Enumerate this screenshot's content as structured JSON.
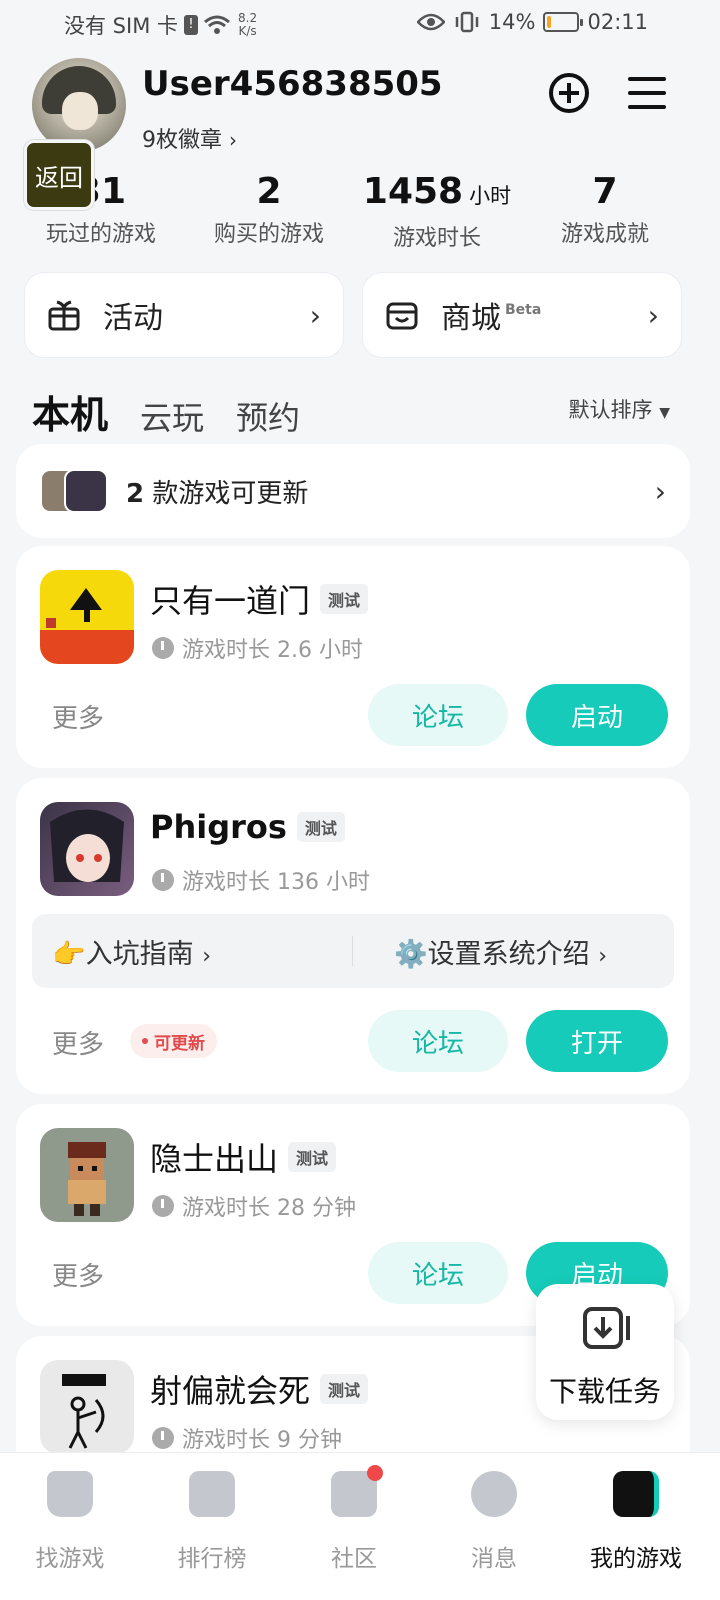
{
  "status_bar": {
    "carrier": "没有 SIM 卡",
    "net_speed_value": "8.2",
    "net_speed_unit": "K/s",
    "battery": "14%",
    "battery_level": 0.14,
    "time": "02:11"
  },
  "profile": {
    "username": "User456838505",
    "badges": "9枚徽章",
    "back_label": "返回"
  },
  "stats": [
    {
      "value": "31",
      "unit": "",
      "label": "玩过的游戏"
    },
    {
      "value": "2",
      "unit": "",
      "label": "购买的游戏"
    },
    {
      "value": "1458",
      "unit": "小时",
      "label": "游戏时长"
    },
    {
      "value": "7",
      "unit": "",
      "label": "游戏成就"
    }
  ],
  "quick": {
    "activity": "活动",
    "mall": "商城",
    "mall_badge": "Beta"
  },
  "tabs": [
    "本机",
    "云玩",
    "预约"
  ],
  "sort_label": "默认排序",
  "update_bar": {
    "count": "2",
    "text": "款游戏可更新"
  },
  "games": [
    {
      "name": "只有一道门",
      "tag": "测试",
      "playtime": "游戏时长 2.6 小时",
      "more": "更多",
      "forum": "论坛",
      "action": "启动"
    },
    {
      "name": "Phigros",
      "tag": "测试",
      "playtime": "游戏时长 136 小时",
      "more": "更多",
      "forum": "论坛",
      "action": "打开",
      "update_badge": "可更新",
      "guide_left": "👉入坑指南",
      "guide_right": "⚙️设置系统介绍"
    },
    {
      "name": "隐士出山",
      "tag": "测试",
      "playtime": "游戏时长 28 分钟",
      "more": "更多",
      "forum": "论坛",
      "action": "启动"
    },
    {
      "name": "射偏就会死",
      "tag": "测试",
      "playtime": "游戏时长 9 分钟"
    }
  ],
  "download_task": "下载任务",
  "nav": [
    {
      "label": "找游戏",
      "icon": "find-game-icon"
    },
    {
      "label": "排行榜",
      "icon": "ranking-icon"
    },
    {
      "label": "社区",
      "icon": "community-icon"
    },
    {
      "label": "消息",
      "icon": "message-icon"
    },
    {
      "label": "我的游戏",
      "icon": "my-games-icon"
    }
  ],
  "colors": {
    "accent": "#16cbb9",
    "accent_light": "#e6f9f7",
    "update_red": "#e24b4b"
  }
}
